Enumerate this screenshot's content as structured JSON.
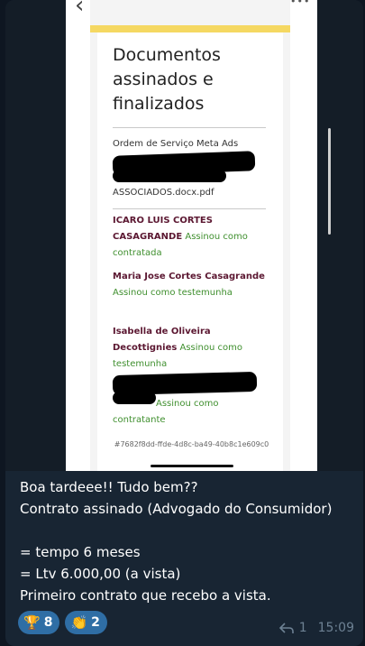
{
  "document": {
    "title": "Documentos assinados e finalizados",
    "file_name_line1": "Ordem de Serviço Meta Ads",
    "file_name_line2": "ASSOCIADOS.docx.pdf",
    "signers": [
      {
        "name": "ICARO LUIS CORTES CASAGRANDE",
        "status": "Assinou como contratada"
      },
      {
        "name": "Maria Jose Cortes Casagrande",
        "status": "Assinou como testemunha"
      },
      {
        "name": "Isabella de Oliveira Decottignies",
        "status": "Assinou como testemunha"
      },
      {
        "name": "",
        "status": "Assinou como contratante"
      }
    ],
    "hash": "#7682f8dd-ffde-4d8c-ba49-40b8c1e609c0"
  },
  "message": {
    "lines": [
      "Boa tardeee!! Tudo bem??",
      "Contrato assinado (Advogado do Consumidor)",
      "",
      "= tempo 6 meses",
      "= Ltv 6.000,00 (a vista)",
      "Primeiro contrato que recebo a vista."
    ],
    "reactions": [
      {
        "emoji": "🏆",
        "icon": "trophy-icon",
        "count": "8"
      },
      {
        "emoji": "👏",
        "icon": "clap-icon",
        "count": "2"
      }
    ],
    "reply_count": "1",
    "time": "15:09"
  },
  "colors": {
    "chat_bg": "#0e1621",
    "bubble": "#182533",
    "reaction_pill": "#2f6ea5",
    "signer_name": "#5b1731",
    "signed_status": "#3f8f2e",
    "doc_accent": "#f5d862"
  }
}
